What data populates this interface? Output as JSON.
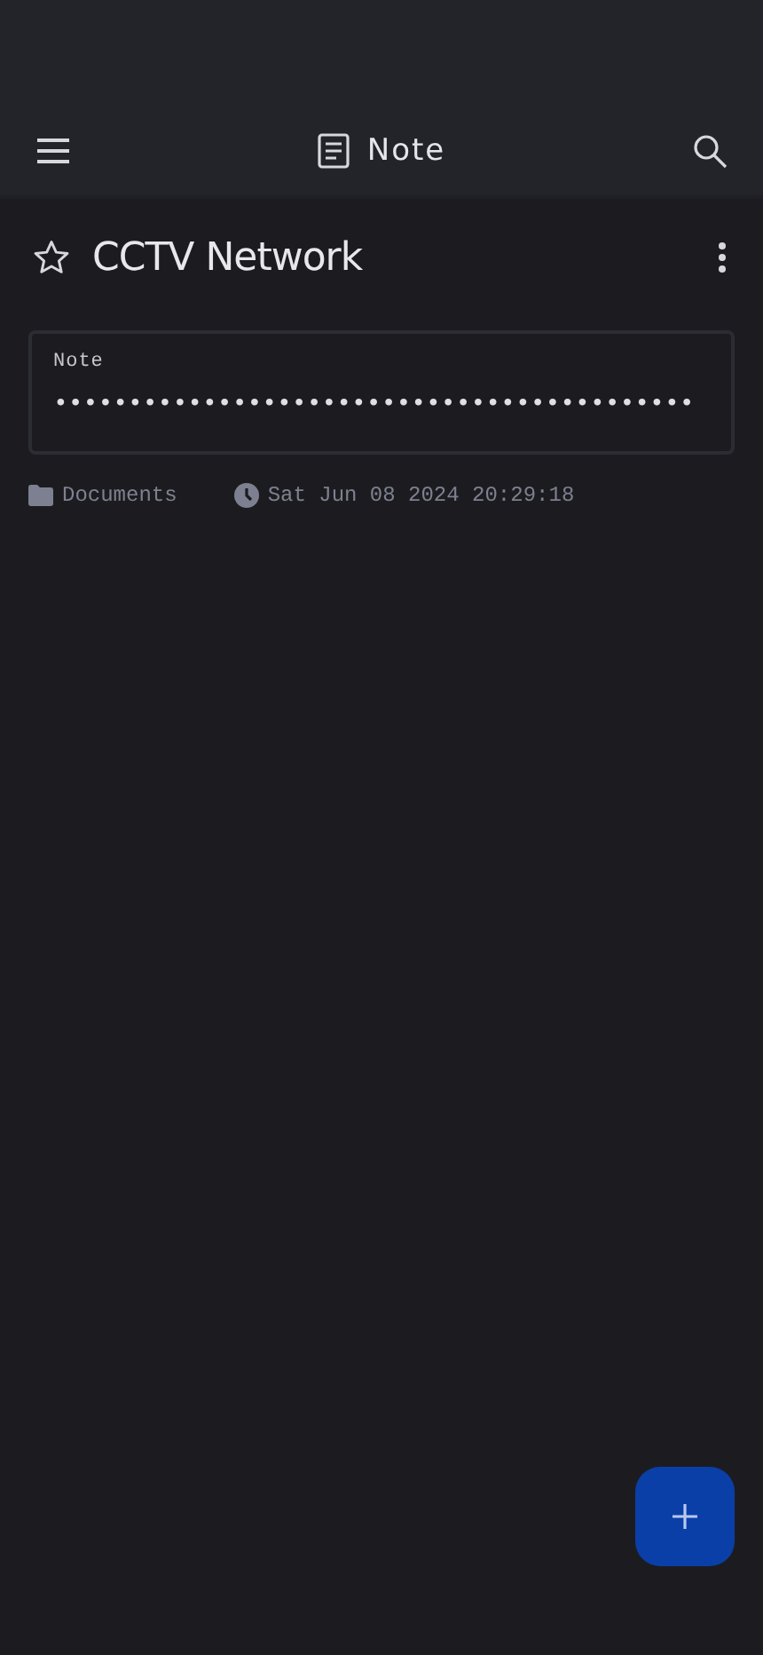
{
  "app_bar": {
    "title": "Note"
  },
  "entry": {
    "title": "CCTV Network",
    "starred": false
  },
  "note_field": {
    "label": "Note",
    "value": "•••••••••••••••••••••••••••••••••••••••••••"
  },
  "meta": {
    "folder": "Documents",
    "modified": "Sat Jun 08 2024 20:29:18"
  }
}
